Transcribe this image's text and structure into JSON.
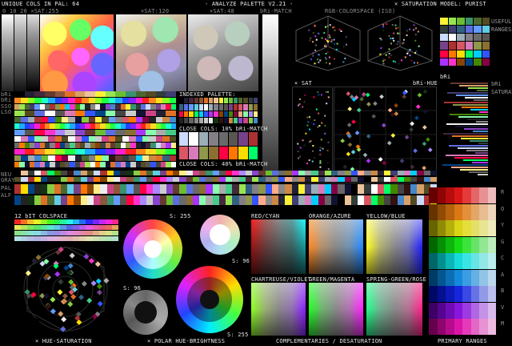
{
  "header": {
    "left": "UNIQUE COLS IN PAL: 64",
    "center": "- ANALYZE PALETTE V2.21 -",
    "right": "× SATURATION MODEL: PURIST"
  },
  "top_labels": {
    "hues_row": "0 10 20 ×SAT:255",
    "sat120": "×SAT:120",
    "sat48": "×SAT:48",
    "bri_match": "bRi-MATCH",
    "rgb_space": "RGB-COLORSPACE (ISO)"
  },
  "side_right": {
    "useful_ranges": "USEFUL RANGES",
    "bri": "bRi",
    "bri_saturation": "bRi SATURATION"
  },
  "left_side": [
    "bRi",
    "bRi",
    "SSO",
    "LSO"
  ],
  "mid_panel": {
    "indexed": "INDEXED PALETTE:",
    "close10": "CLOSE COLS: 10% bRi-MATCH",
    "close40": "CLOSE COLS: 40% bRi-MATCH"
  },
  "scatter": {
    "sat": "× SAT",
    "bri_hue": "bRi-HUE"
  },
  "rows_labels": [
    "NEU",
    "GRAY",
    "PAL",
    "ALF"
  ],
  "bit12": "12 bIT COLSPACE",
  "polar_labels": {
    "s255a": "S: 255",
    "s96a": "S: 96",
    "s96b": "S: 96",
    "s255b": "S: 255"
  },
  "complements": [
    "RED/CYAN",
    "ORANGE/AZURE",
    "YELLOW/BLUE",
    "CHARTREUSE/VIOLET",
    "GREEN/MAGENTA",
    "SPRING-GREEN/ROSE"
  ],
  "right_letters": [
    "R",
    "O",
    "Y",
    "G",
    "C",
    "A",
    "B",
    "V",
    "M"
  ],
  "footer": {
    "hue_sat": "× HUE-SATURATION",
    "polar": "× POLAR HUE-BRIGHTNESS",
    "complementaries": "COMPLEMENTARIES / DESATURATION",
    "primary": "PRIMARY RANGES"
  },
  "palette": [
    "#000000",
    "#222034",
    "#45283c",
    "#663931",
    "#8f563b",
    "#df7126",
    "#d9a066",
    "#eec39a",
    "#fbf236",
    "#99e550",
    "#6abe30",
    "#37946e",
    "#4b692f",
    "#524b24",
    "#323c39",
    "#3f3f74",
    "#306082",
    "#5b6ee1",
    "#639bff",
    "#5fcde4",
    "#cbdbfc",
    "#ffffff",
    "#9badb7",
    "#847e87",
    "#696a6a",
    "#595652",
    "#76428a",
    "#ac3232",
    "#d95763",
    "#d77bba",
    "#8f974a",
    "#8a6f30",
    "#ff0044",
    "#ff7700",
    "#ffdd00",
    "#00ff66",
    "#00ccff",
    "#3355ff",
    "#aa33ff",
    "#ff33cc",
    "#884400",
    "#004488",
    "#448800",
    "#880044",
    "#ffaa88",
    "#88ffaa",
    "#aa88ff",
    "#ffee88",
    "#222222",
    "#444444",
    "#666666",
    "#888888",
    "#aaaaaa",
    "#cccccc",
    "#eeeeee",
    "#113311",
    "#331111",
    "#111133",
    "#cc8844",
    "#44cc88",
    "#8844cc",
    "#cc4488",
    "#88cc44",
    "#4488cc"
  ]
}
